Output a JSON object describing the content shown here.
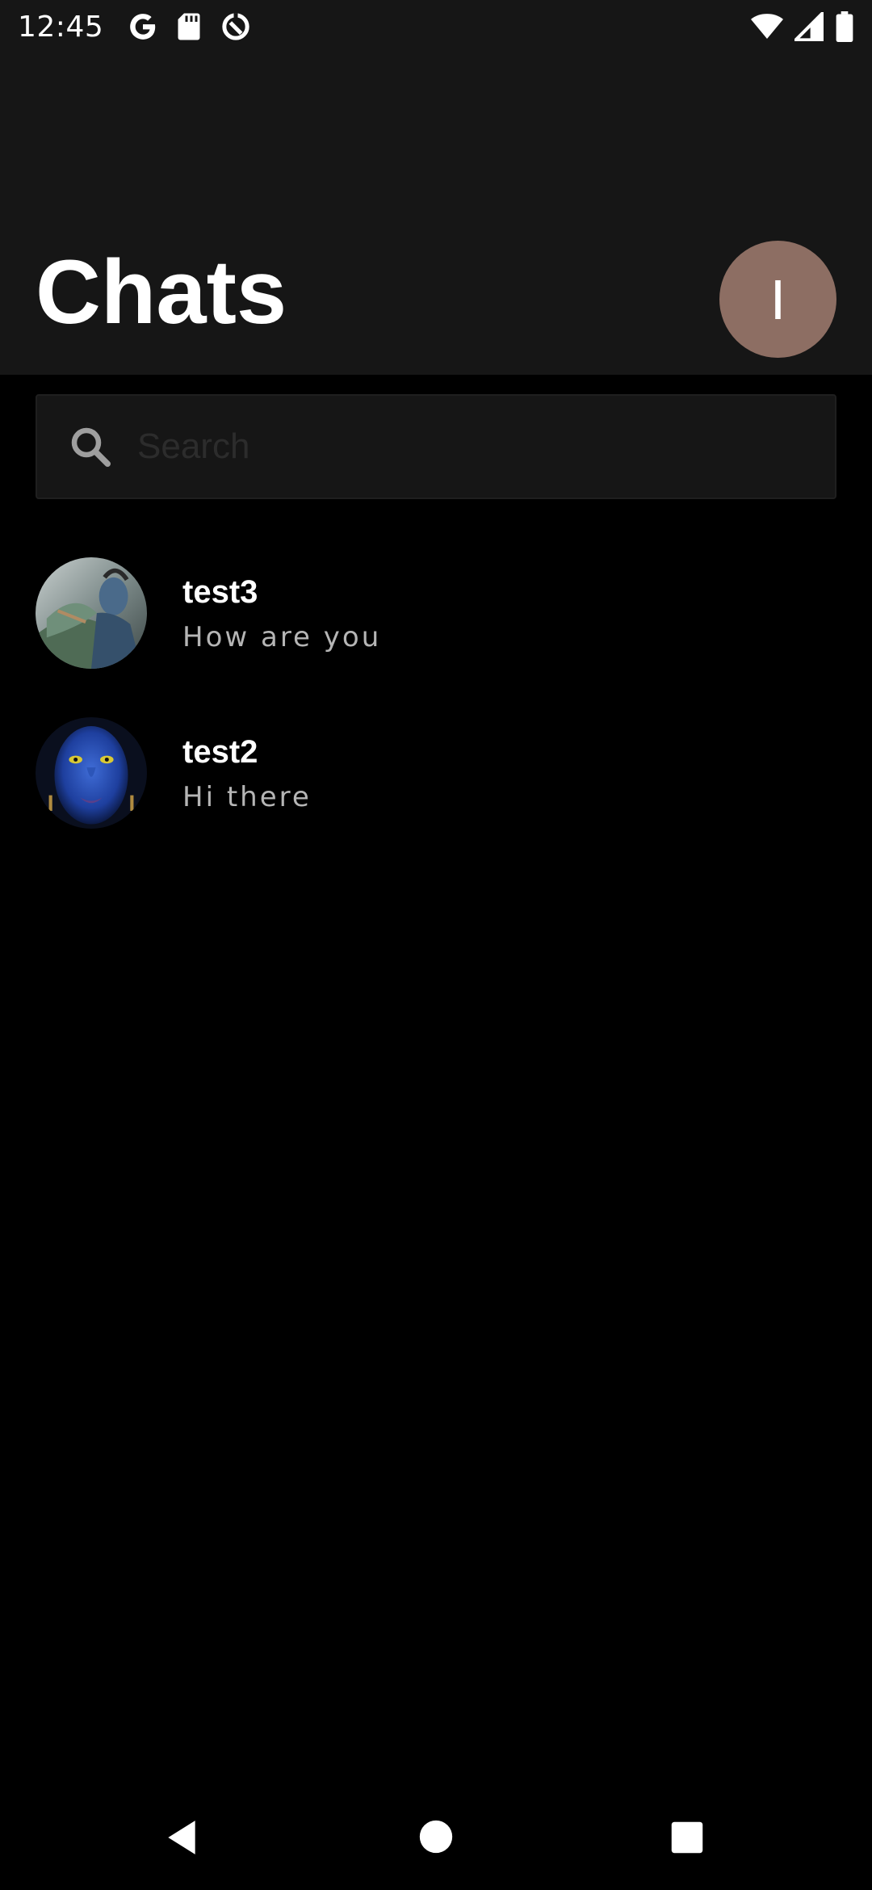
{
  "status_bar": {
    "time": "12:45",
    "left_icons": [
      "google-icon",
      "sd-card-icon",
      "data-saver-icon"
    ],
    "right_icons": [
      "wifi-icon",
      "cell-signal-icon",
      "battery-icon"
    ]
  },
  "header": {
    "title": "Chats",
    "profile_initial": "I",
    "profile_color": "#8d6e63"
  },
  "search": {
    "placeholder": "Search",
    "value": ""
  },
  "chats": [
    {
      "name": "test3",
      "preview": "How are you"
    },
    {
      "name": "test2",
      "preview": "Hi there"
    }
  ],
  "nav_bar": {
    "buttons": [
      "back-icon",
      "home-icon",
      "recents-icon"
    ]
  },
  "colors": {
    "background": "#000000",
    "header_background": "#161616",
    "preview_text": "#b5b5b5"
  }
}
